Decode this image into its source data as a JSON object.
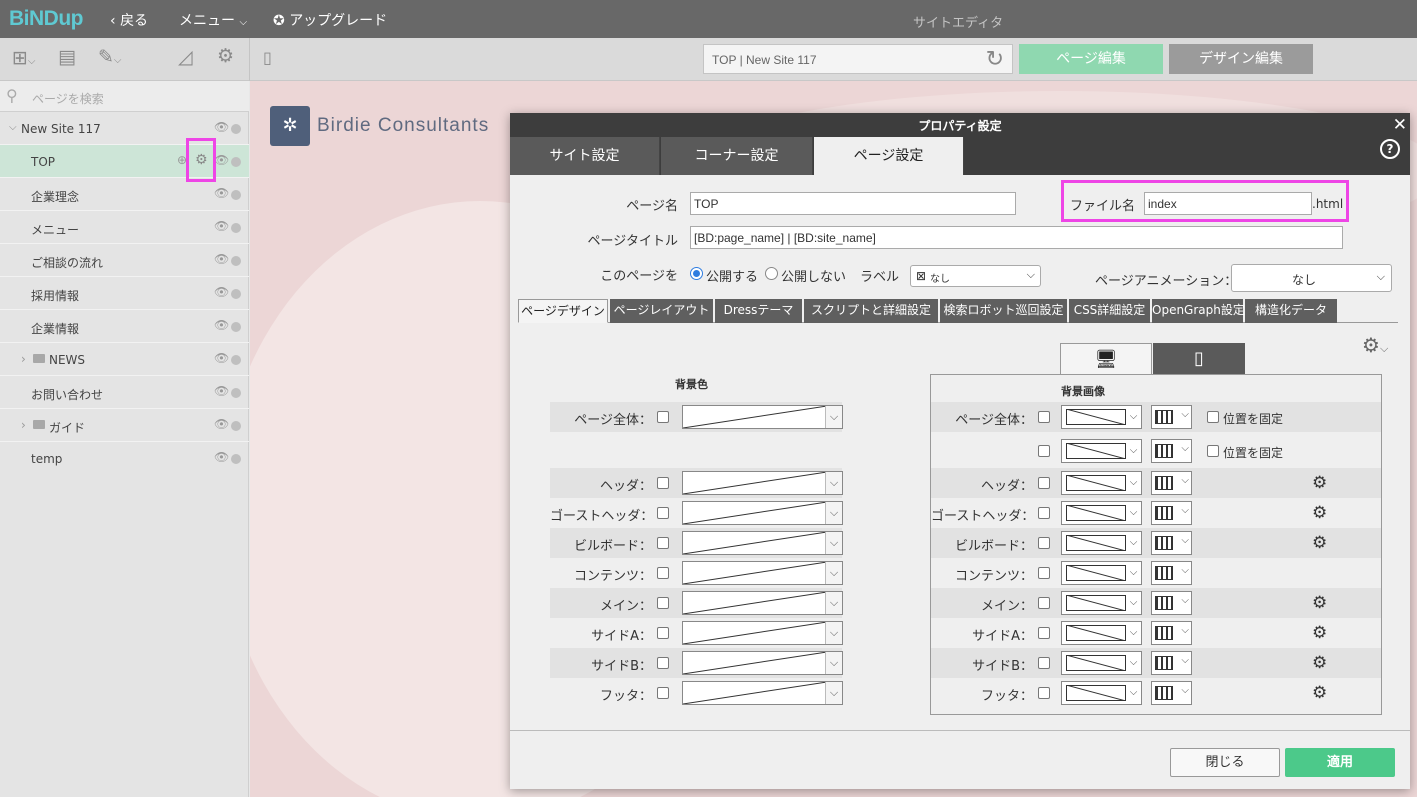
{
  "app": {
    "logo": "BiNDup",
    "back_label": "戻る",
    "menu_label": "メニュー",
    "upgrade_label": "アップグレード",
    "window_title": "サイトエディタ"
  },
  "toolbar": {
    "url_text": "TOP | New Site 117",
    "page_edit_label": "ページ編集",
    "design_edit_label": "デザイン編集"
  },
  "sidebar": {
    "search_placeholder": "ページを検索",
    "site_name": "New Site 117",
    "items": [
      {
        "label": "TOP",
        "selected": true
      },
      {
        "label": "企業理念"
      },
      {
        "label": "メニュー"
      },
      {
        "label": "ご相談の流れ"
      },
      {
        "label": "採用情報"
      },
      {
        "label": "企業情報"
      },
      {
        "label": "NEWS",
        "folder": true
      },
      {
        "label": "お問い合わせ"
      },
      {
        "label": "ガイド",
        "folder": true
      },
      {
        "label": "temp"
      }
    ]
  },
  "site_preview": {
    "brand_name": "Birdie Consultants"
  },
  "dialog": {
    "title": "プロパティ設定",
    "tabs": [
      "サイト設定",
      "コーナー設定",
      "ページ設定"
    ],
    "active_tab": "ページ設定",
    "page_name_label": "ページ名",
    "page_name_value": "TOP",
    "file_name_label": "ファイル名",
    "file_name_value": "index",
    "file_ext": ".html",
    "page_title_label": "ページタイトル",
    "page_title_value": "[BD:page_name] | [BD:site_name]",
    "publish_label": "このページを",
    "publish_on": "公開する",
    "publish_off": "公開しない",
    "label_label": "ラベル",
    "label_value": "なし",
    "animation_label": "ページアニメーション：",
    "animation_value": "なし",
    "subtabs": [
      "ページデザイン",
      "ページレイアウト",
      "Dressテーマ",
      "スクリプトと詳細設定",
      "検索ロボット巡回設定",
      "CSS詳細設定",
      "OpenGraph設定",
      "構造化データ"
    ],
    "bg_color_title": "背景色",
    "bg_image_title": "背景画像",
    "fix_position_label": "位置を固定",
    "rows": [
      "ページ全体：",
      "ヘッダ：",
      "ゴーストヘッダ：",
      "ビルボード：",
      "コンテンツ：",
      "メイン：",
      "サイドA：",
      "サイドB：",
      "フッタ："
    ],
    "close_label": "閉じる",
    "apply_label": "適用"
  },
  "colors": {
    "topbar": "#686868",
    "accent_green": "#4cc98a",
    "highlight": "#ee45e6",
    "logo": "#5fc9d2"
  }
}
